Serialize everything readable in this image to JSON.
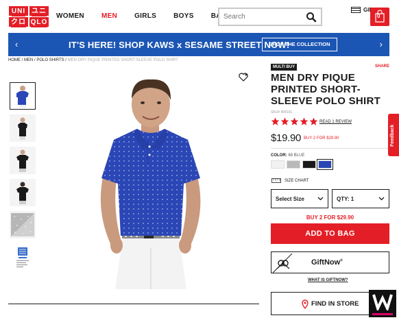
{
  "header": {
    "logo": {
      "cells": [
        "UNI",
        "ユニ",
        "クロ",
        "QLO"
      ]
    },
    "nav": [
      {
        "label": "WOMEN",
        "active": false
      },
      {
        "label": "MEN",
        "active": true
      },
      {
        "label": "GIRLS",
        "active": false
      },
      {
        "label": "BOYS",
        "active": false
      },
      {
        "label": "BABY",
        "active": false
      }
    ],
    "search_placeholder": "Search",
    "gift_label": "GIF",
    "cart_count": "0"
  },
  "banner": {
    "text": "IT'S HERE! SHOP KAWS x SESAME STREET NOW!",
    "button": "SHOP THE COLLECTION",
    "left_arrow": "‹",
    "right_arrow": "›"
  },
  "breadcrumb": {
    "items": [
      "HOME",
      "MEN",
      "POLO SHIRTS"
    ],
    "separator": " / ",
    "current": "MEN DRY PIQUE PRINTED SHORT-SLEEVE POLO SHIRT"
  },
  "product": {
    "badge": "MULTI BUY",
    "share": "SHARE",
    "title": "MEN DRY PIQUE PRINTED SHORT-SLEEVE POLO SHIRT",
    "sku": "SKU# 404161",
    "rating": 5,
    "review_link": "READ 1 REVIEW",
    "price": "$19.90",
    "price_promo": "BUY 2 FOR $29.90",
    "color_label": "COLOR:",
    "color_value": "68 BLUE",
    "swatches": [
      {
        "name": "white",
        "color": "#f2f2f2"
      },
      {
        "name": "gray",
        "color": "#b9b9b9"
      },
      {
        "name": "black",
        "color": "#1a1a1a"
      },
      {
        "name": "blue",
        "color": "#2b46b5"
      }
    ],
    "size_chart": "SIZE CHART",
    "size_select": "Select Size",
    "qty_select": "QTY: 1",
    "promo_red": "BUY 2 FOR $29.90",
    "add_to_bag": "ADD TO BAG",
    "giftnow": "GiftNow",
    "giftnow_mark": "®",
    "what_giftnow": "WHAT IS GIFTNOW?",
    "find_in_store": "FIND IN STORE"
  },
  "feedback": "Feedback",
  "colors": {
    "brand_red": "#e41e26",
    "banner_blue": "#1c56b4",
    "shirt_blue": "#2b46b5"
  }
}
